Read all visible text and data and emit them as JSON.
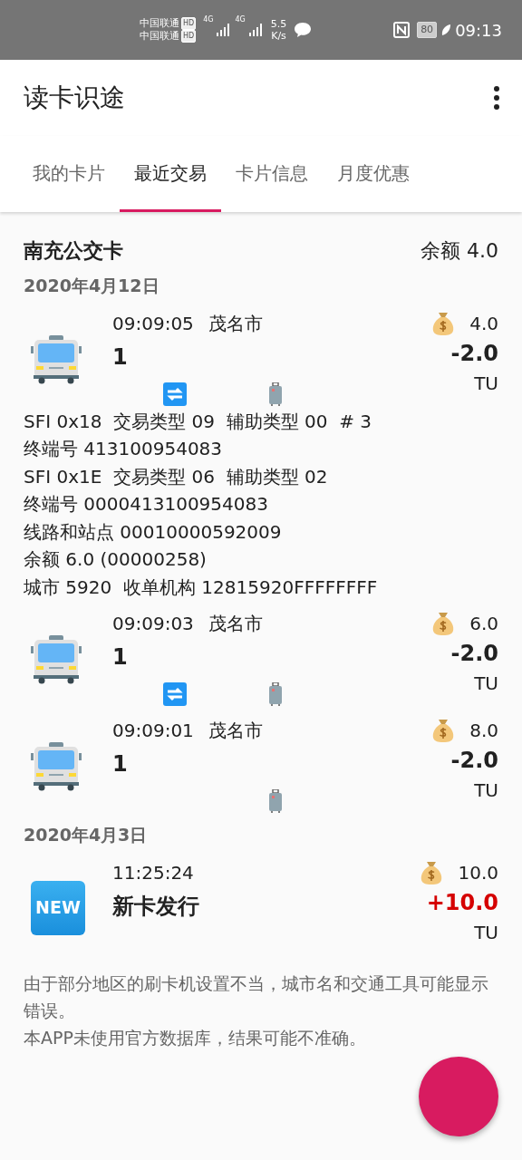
{
  "status_bar": {
    "carriers": [
      {
        "name": "中国联通",
        "badge": "HD"
      },
      {
        "name": "中国联通",
        "badge": "HD"
      }
    ],
    "network": [
      "4G",
      "4G"
    ],
    "speed": "5.5",
    "speed_unit": "K/s",
    "battery": "80",
    "time": "09:13"
  },
  "app_bar": {
    "title": "读卡识途"
  },
  "tabs": [
    {
      "label": "我的卡片",
      "selected": false
    },
    {
      "label": "最近交易",
      "selected": true
    },
    {
      "label": "卡片信息",
      "selected": false
    },
    {
      "label": "月度优惠",
      "selected": false
    }
  ],
  "card": {
    "name": "南充公交卡",
    "balance": "余额 4.0"
  },
  "groups": [
    {
      "date": "2020年4月12日",
      "transactions": [
        {
          "kind": "bus",
          "time": "09:09:05",
          "city": "茂名市",
          "title": "1",
          "balance": "4.0",
          "amount": "-2.0",
          "positive": false,
          "unit": "TU",
          "transfer": true,
          "luggage": true,
          "details": [
            "SFI 0x18  交易类型 09  辅助类型 00  # 3",
            "终端号 413100954083",
            "SFI 0x1E  交易类型 06  辅助类型 02",
            "终端号 0000413100954083",
            "线路和站点 00010000592009",
            "余额 6.0 (00000258)",
            "城市 5920  收单机构 12815920FFFFFFFF"
          ]
        },
        {
          "kind": "bus",
          "time": "09:09:03",
          "city": "茂名市",
          "title": "1",
          "balance": "6.0",
          "amount": "-2.0",
          "positive": false,
          "unit": "TU",
          "transfer": true,
          "luggage": true
        },
        {
          "kind": "bus",
          "time": "09:09:01",
          "city": "茂名市",
          "title": "1",
          "balance": "8.0",
          "amount": "-2.0",
          "positive": false,
          "unit": "TU",
          "transfer": false,
          "luggage": true
        }
      ]
    },
    {
      "date": "2020年4月3日",
      "transactions": [
        {
          "kind": "new",
          "badge": "NEW",
          "time": "11:25:24",
          "title": "新卡发行",
          "balance": "10.0",
          "amount": "+10.0",
          "positive": true,
          "unit": "TU",
          "transfer": false,
          "luggage": false
        }
      ]
    }
  ],
  "notes": [
    "由于部分地区的刷卡机设置不当，城市名和交通工具可能显示错误。",
    "本APP未使用官方数据库，结果可能不准确。"
  ]
}
